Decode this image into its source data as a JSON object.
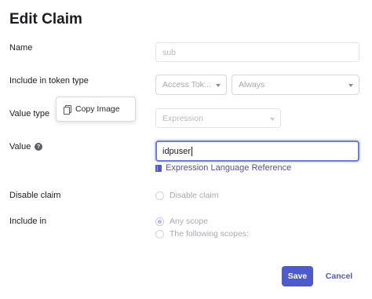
{
  "dialog": {
    "title": "Edit Claim"
  },
  "name": {
    "label": "Name",
    "value": "sub"
  },
  "token_type": {
    "label": "Include in token type",
    "type_value": "Access Tok...",
    "when_value": "Always"
  },
  "value_type": {
    "label": "Value type",
    "value": "Expression"
  },
  "value": {
    "label": "Value",
    "help_icon": "?",
    "input_value": "idpuser"
  },
  "expression_link": {
    "label": "Expression Language Reference",
    "icon": "book-icon"
  },
  "disable_claim": {
    "label": "Disable claim",
    "checkbox_label": "Disable claim"
  },
  "include_in": {
    "label": "Include in",
    "options": [
      "Any scope",
      "The following scopes:"
    ],
    "selected": "Any scope"
  },
  "context_menu": {
    "item": "Copy Image",
    "icon": "copy-icon"
  },
  "actions": {
    "save": "Save",
    "cancel": "Cancel"
  },
  "colors": {
    "primary": "#4e5bcf",
    "link": "#5a4e9b",
    "focus_border": "#6f7cd6"
  }
}
